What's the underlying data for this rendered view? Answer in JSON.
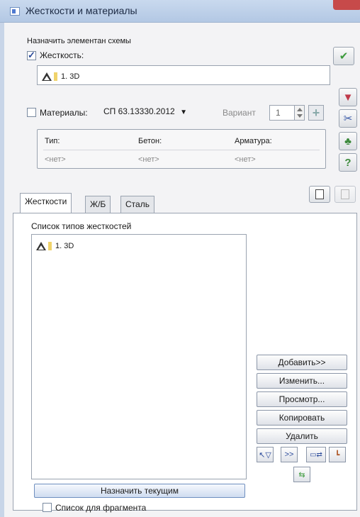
{
  "window": {
    "title": "Жесткости и материалы"
  },
  "assign_group": {
    "title": "Назначить элементан схемы"
  },
  "stiffness": {
    "label": "Жесткость:",
    "checked": true,
    "selected": "1. 3D"
  },
  "materials": {
    "label": "Материалы:",
    "checked": false,
    "standard": "СП 63.13330.2012",
    "variant_label": "Вариант",
    "variant_value": "1",
    "plus": "+",
    "columns": [
      "Тип:",
      "Бетон:",
      "Арматура:"
    ],
    "values": [
      "<нет>",
      "<нет>",
      "<нет>"
    ]
  },
  "side_icons": [
    "ok-check-icon",
    "filter-icon",
    "scissors-icon",
    "brush-icon",
    "help-icon"
  ],
  "tabs": [
    "Жесткости",
    "Ж/Б",
    "Сталь"
  ],
  "active_tab": "Жесткости",
  "list": {
    "title": "Список типов жесткостей",
    "items": [
      "1. 3D"
    ]
  },
  "buttons": {
    "add": "Добавить>>",
    "edit": "Изменить...",
    "view": "Просмотр...",
    "copy": "Копировать",
    "delete": "Удалить",
    "more": ">>",
    "assign_current": "Назначить текущим"
  },
  "fragment": {
    "label": "Список для фрагмента",
    "checked": false
  },
  "colors": {
    "ok": "#3c9a3c",
    "accent": "#2a4a9a"
  }
}
